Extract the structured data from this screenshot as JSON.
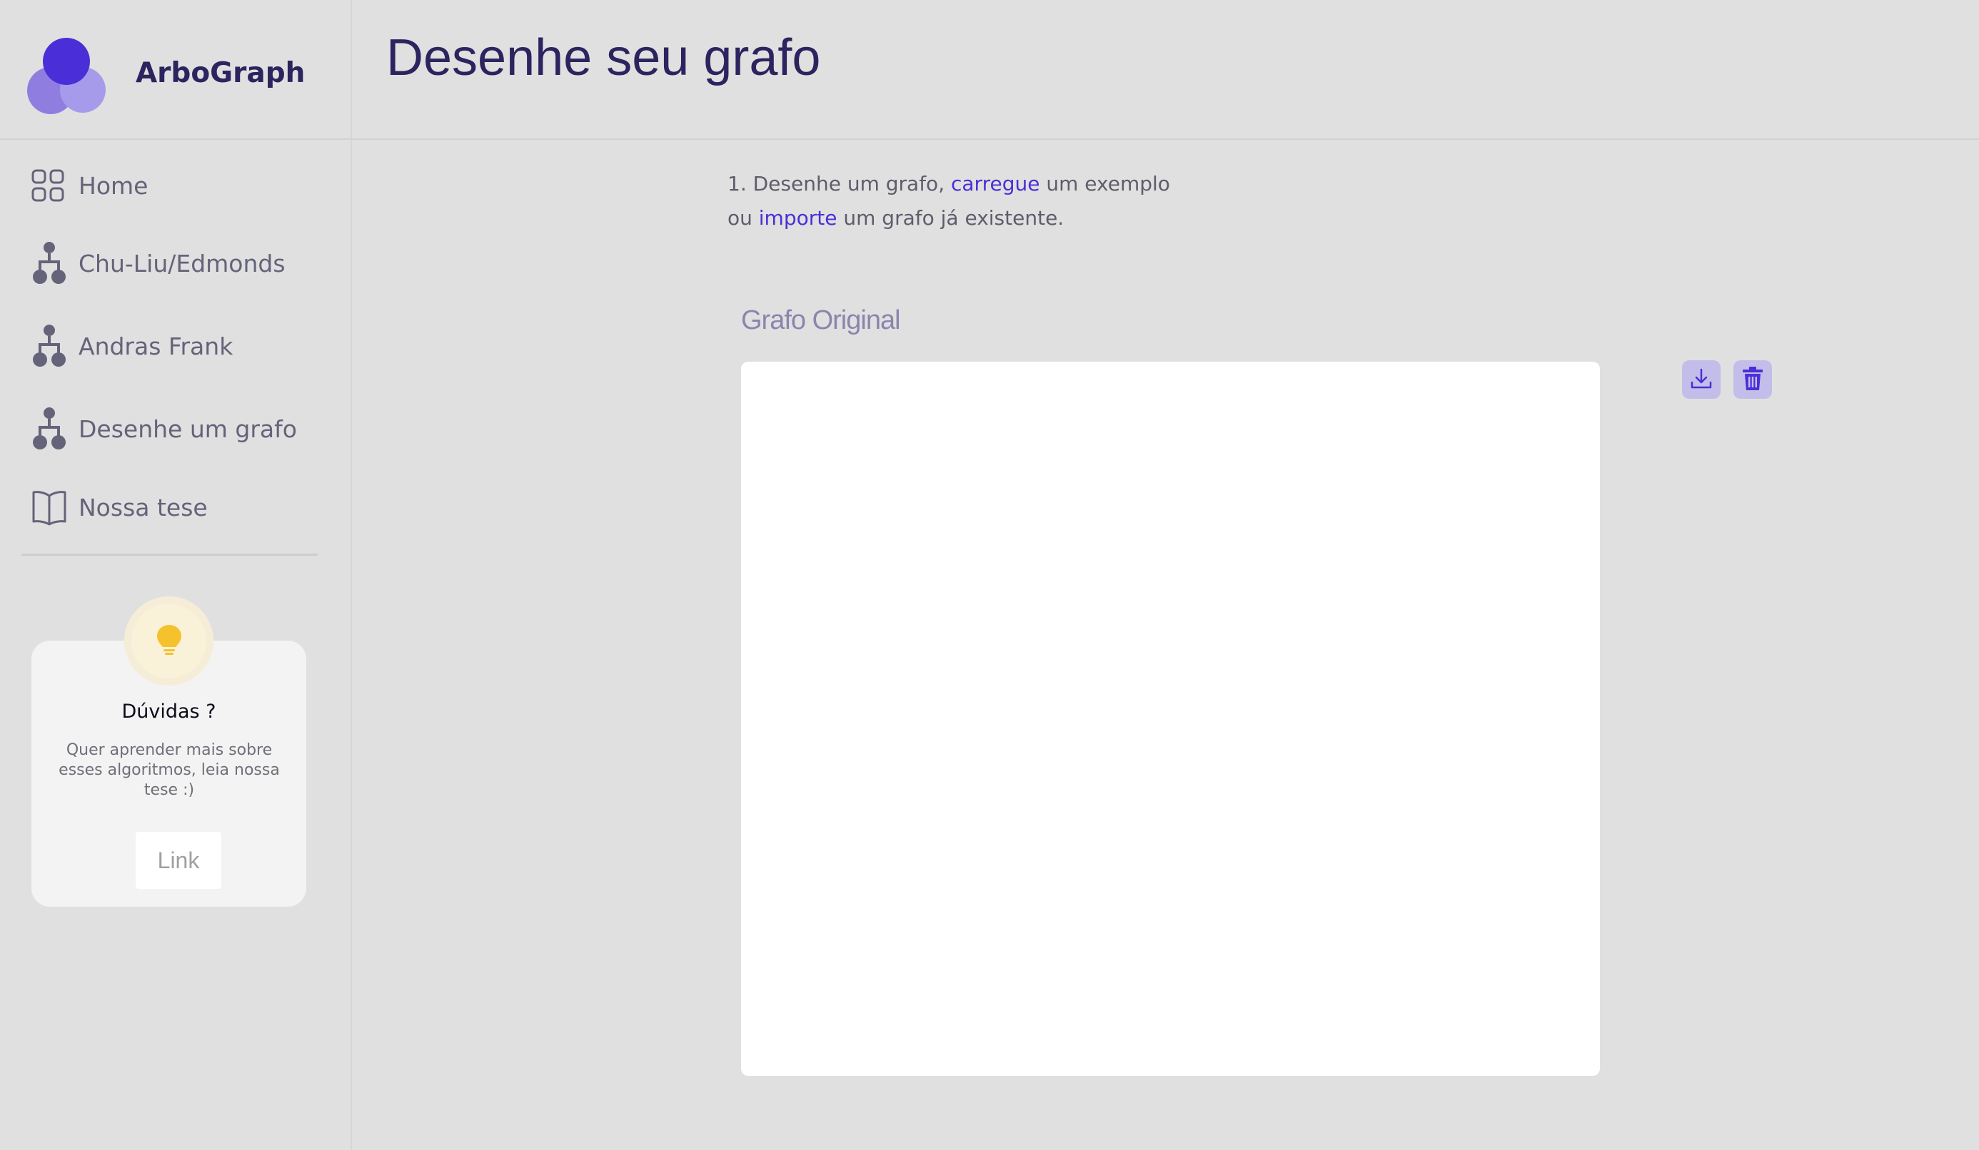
{
  "app": {
    "name": "ArboGraph"
  },
  "sidebar": {
    "items": [
      {
        "label": "Home",
        "icon": "grid-icon"
      },
      {
        "label": "Chu-Liu/Edmonds",
        "icon": "hierarchy-icon"
      },
      {
        "label": "Andras Frank",
        "icon": "hierarchy-icon"
      },
      {
        "label": "Desenhe um grafo",
        "icon": "hierarchy-icon"
      },
      {
        "label": "Nossa tese",
        "icon": "book-icon"
      }
    ]
  },
  "help_card": {
    "icon": "lightbulb-icon",
    "title": "Dúvidas ?",
    "text": "Quer aprender mais sobre esses algoritmos, leia nossa tese :)",
    "link_label": "Link"
  },
  "header": {
    "title": "Desenhe seu grafo"
  },
  "instructions": {
    "line1_prefix": "1. Desenhe um grafo, ",
    "load_link": "carregue",
    "line1_suffix": " um exemplo",
    "line2_prefix": "ou ",
    "import_link": "importe",
    "line2_suffix": " um grafo já existente."
  },
  "panel": {
    "title": "Grafo Original"
  },
  "toolbar": {
    "download_icon": "download-icon",
    "delete_icon": "trash-icon"
  },
  "colors": {
    "accent": "#4a2fd8",
    "title": "#2c245e",
    "background": "#e0e0e0",
    "tool_button": "#c3bdea",
    "bulb": "#f5c22e"
  }
}
